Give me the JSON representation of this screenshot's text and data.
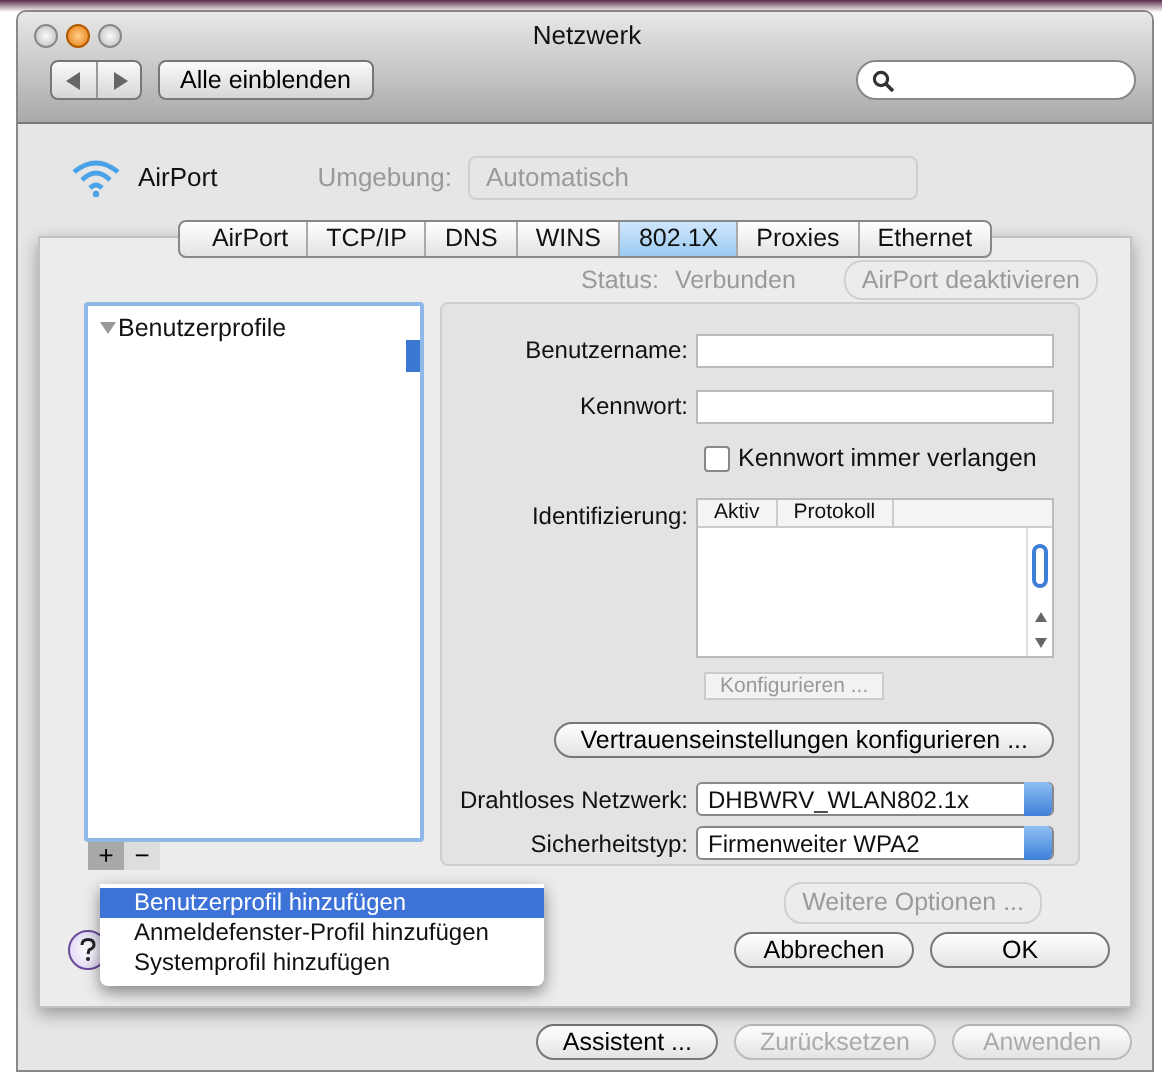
{
  "window": {
    "title": "Netzwerk"
  },
  "toolbar": {
    "show_all_button": "Alle einblenden"
  },
  "service": {
    "name": "AirPort"
  },
  "location": {
    "label": "Umgebung:",
    "value": "Automatisch"
  },
  "background_status": {
    "label": "Status:",
    "value": "Verbunden",
    "button": "AirPort deaktivieren"
  },
  "tabs": [
    {
      "label": "AirPort",
      "selected": false
    },
    {
      "label": "TCP/IP",
      "selected": false
    },
    {
      "label": "DNS",
      "selected": false
    },
    {
      "label": "WINS",
      "selected": false
    },
    {
      "label": "802.1X",
      "selected": true
    },
    {
      "label": "Proxies",
      "selected": false
    },
    {
      "label": "Ethernet",
      "selected": false
    }
  ],
  "profiles": {
    "header": "Benutzerprofile",
    "expanded": true
  },
  "list_buttons": [
    "+",
    "−"
  ],
  "add_menu": [
    {
      "label": "Benutzerprofil hinzufügen",
      "selected": true
    },
    {
      "label": "Anmeldefenster-Profil hinzufügen",
      "selected": false
    },
    {
      "label": "Systemprofil hinzufügen",
      "selected": false
    }
  ],
  "form": {
    "username_label": "Benutzername:",
    "password_label": "Kennwort:",
    "always_ask": {
      "label": "Kennwort immer verlangen",
      "checked": false
    },
    "auth_label": "Identifizierung:",
    "auth_columns": [
      "Aktiv",
      "Protokoll"
    ],
    "configure_button": {
      "label": "Konfigurieren ...",
      "disabled": true
    },
    "trust_button": "Vertrauenseinstellungen konfigurieren ...",
    "network": {
      "label": "Drahtloses Netzwerk:",
      "value": "DHBWRV_WLAN802.1x"
    },
    "security": {
      "label": "Sicherheitstyp:",
      "value": "Firmenweiter WPA2"
    }
  },
  "background_more_button": "Weitere Optionen ...",
  "sheet_buttons": [
    "Abbrechen",
    "OK"
  ],
  "footer_buttons": [
    {
      "label": "Assistent ...",
      "disabled": false
    },
    {
      "label": "Zurücksetzen",
      "disabled": true
    },
    {
      "label": "Anwenden",
      "disabled": true
    }
  ]
}
